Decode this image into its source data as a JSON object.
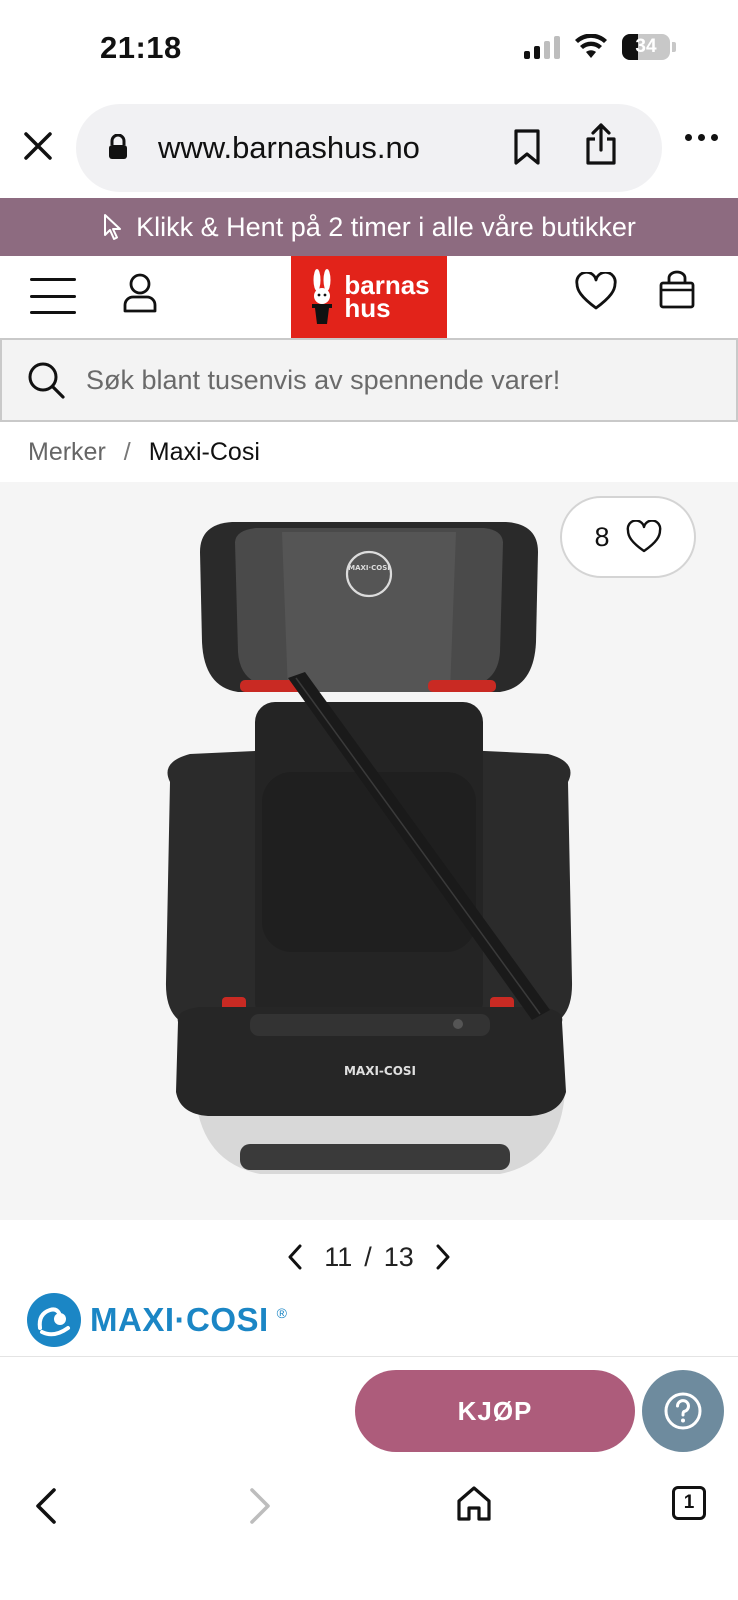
{
  "status_bar": {
    "time": "21:18",
    "battery_level": "34"
  },
  "browser": {
    "url": "www.barnashus.no",
    "tab_count": "1"
  },
  "promo_banner": {
    "text": "Klikk & Hent på 2 timer i alle våre butikker"
  },
  "site_header": {
    "logo_line1": "barnas",
    "logo_line2": "hus",
    "logo_color": "#e2231a"
  },
  "search": {
    "placeholder": "Søk blant tusenvis av spennende varer!"
  },
  "breadcrumb": {
    "parent": "Merker",
    "separator": "/",
    "current": "Maxi-Cosi"
  },
  "gallery": {
    "like_count": "8",
    "current_image": "11",
    "separator": "/",
    "total_images": "13",
    "seat_head_logo": "MAXI·COSI",
    "seat_base_logo": "MAXI-COSI"
  },
  "brand": {
    "name": "MAXI·COSI",
    "mark": "®",
    "color": "#1b86c5"
  },
  "actions": {
    "buy_label": "KJØP",
    "buy_color": "#ad5c7b",
    "help_color": "#6e8b9e"
  },
  "theme": {
    "promo_bg": "#8d6b80"
  }
}
